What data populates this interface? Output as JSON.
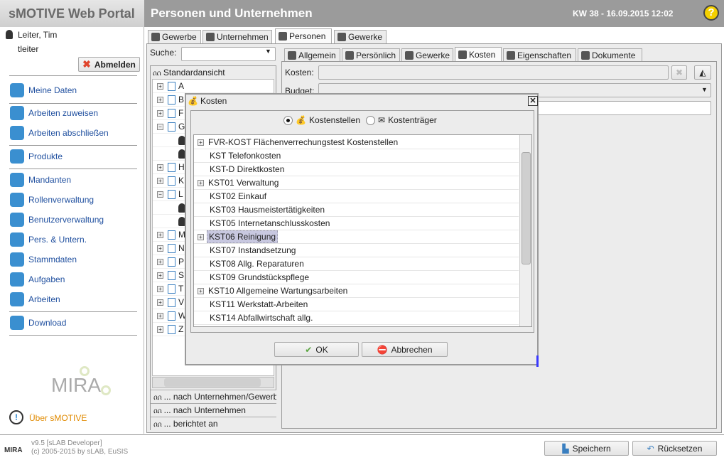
{
  "header": {
    "app_title": "sMOTIVE Web Portal",
    "page_title": "Personen und Unternehmen",
    "date": "KW 38 - 16.09.2015 12:02",
    "help_icon": "?"
  },
  "user": {
    "name": "Leiter, Tim",
    "login": "tleiter",
    "logout": "Abmelden"
  },
  "sidebar": {
    "items": [
      {
        "label": "Meine Daten",
        "icon": "user-icon"
      },
      {
        "label": "Arbeiten zuweisen",
        "icon": "worker-icon"
      },
      {
        "label": "Arbeiten abschließen",
        "icon": "worker-done-icon"
      },
      {
        "label": "Produkte",
        "icon": "product-icon"
      },
      {
        "label": "Mandanten",
        "icon": "client-icon"
      },
      {
        "label": "Rollenverwaltung",
        "icon": "roles-icon"
      },
      {
        "label": "Benutzerverwaltung",
        "icon": "users-icon"
      },
      {
        "label": "Pers. & Untern.",
        "icon": "persons-icon"
      },
      {
        "label": "Stammdaten",
        "icon": "master-data-icon"
      },
      {
        "label": "Aufgaben",
        "icon": "wrench-icon"
      },
      {
        "label": "Arbeiten",
        "icon": "gear-icon"
      },
      {
        "label": "Download",
        "icon": "download-icon"
      }
    ],
    "logo": "MIRA",
    "about": "Über sMOTIVE"
  },
  "footer": {
    "version": "v9.5 [sLAB Developer]",
    "copyright": "(c) 2005-2015 by sLAB, EuSIS",
    "save": "Speichern",
    "reset": "Rücksetzen"
  },
  "main_tabs": [
    "Gewerbe",
    "Unternehmen",
    "Personen",
    "Gewerke"
  ],
  "left": {
    "search_label": "Suche:",
    "search_value": "",
    "view": "Standardansicht",
    "tree": [
      {
        "l": "A",
        "s": "+"
      },
      {
        "l": "B",
        "s": "+"
      },
      {
        "l": "F",
        "s": "+"
      },
      {
        "l": "G",
        "s": "-"
      },
      {
        "l": "",
        "c": 1
      },
      {
        "l": "",
        "c": 1
      },
      {
        "l": "H",
        "s": "+"
      },
      {
        "l": "K",
        "s": "+"
      },
      {
        "l": "L",
        "s": "-"
      },
      {
        "l": "",
        "c": 1
      },
      {
        "l": "",
        "c": 1
      },
      {
        "l": "M",
        "s": "+"
      },
      {
        "l": "N",
        "s": "+"
      },
      {
        "l": "P",
        "s": "+"
      },
      {
        "l": "S",
        "s": "+"
      },
      {
        "l": "T",
        "s": "+"
      },
      {
        "l": "V",
        "s": "+"
      },
      {
        "l": "W",
        "s": "+"
      },
      {
        "l": "Z",
        "s": "+"
      }
    ],
    "views": [
      "... nach Unternehmen/Gewerbe",
      "... nach Unternehmen",
      "... berichtet an"
    ]
  },
  "detail_tabs": [
    "Allgemein",
    "Persönlich",
    "Gewerke",
    "Kosten",
    "Eigenschaften",
    "Dokumente"
  ],
  "detail": {
    "kosten_label": "Kosten:",
    "kosten_value": "",
    "budget_label": "Budget:"
  },
  "dialog": {
    "title": "Kosten",
    "radio_1": "Kostenstellen",
    "radio_2": "Kostenträger",
    "selected_radio": "Kostenstellen",
    "items": [
      {
        "l": "FVR-KOST Flächenverrechungstest Kostenstellen",
        "e": 1
      },
      {
        "l": "KST Telefonkosten"
      },
      {
        "l": "KST-D Direktkosten"
      },
      {
        "l": "KST01 Verwaltung",
        "e": 1
      },
      {
        "l": "KST02 Einkauf"
      },
      {
        "l": "KST03 Hausmeistertätigkeiten"
      },
      {
        "l": "KST05 Internetanschlusskosten"
      },
      {
        "l": "KST06 Reinigung",
        "e": 1,
        "sel": 1
      },
      {
        "l": "KST07 Instandsetzung"
      },
      {
        "l": "KST08 Allg. Reparaturen"
      },
      {
        "l": "KST09 Grundstückspflege"
      },
      {
        "l": "KST10 Allgemeine Wartungsarbeiten",
        "e": 1
      },
      {
        "l": "KST11 Werkstatt-Arbeiten"
      },
      {
        "l": "KST14 Abfallwirtschaft allg."
      }
    ],
    "ok": "OK",
    "cancel": "Abbrechen"
  },
  "colors": {
    "header": "#9b9b9b",
    "link": "#1f4f9f",
    "about": "#e08a00",
    "selection": "#c8c8e0"
  }
}
